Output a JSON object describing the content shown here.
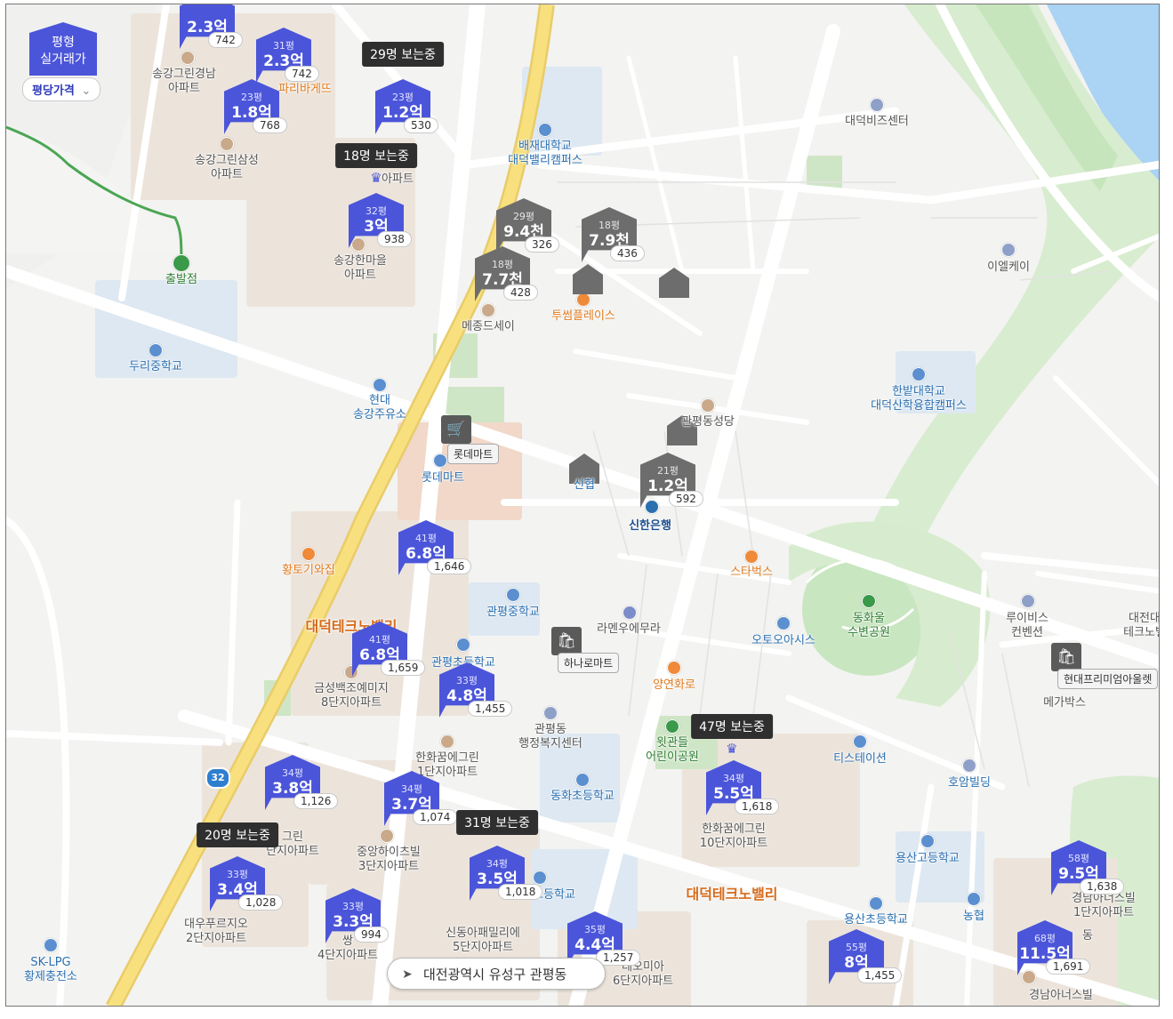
{
  "legend": {
    "line1": "평형",
    "line2": "실거래가",
    "select_value": "평당가격"
  },
  "address": {
    "text": "대전광역시 유성구 관평동"
  },
  "route_number": "32",
  "viewer_badges": [
    {
      "id": "v1",
      "text": "29명 보는중"
    },
    {
      "id": "v2",
      "text": "18명 보는중"
    },
    {
      "id": "v3",
      "text": "47명 보는중"
    },
    {
      "id": "v4",
      "text": "31명 보는중"
    },
    {
      "id": "v5",
      "text": "20명 보는중"
    }
  ],
  "price_markers": [
    {
      "id": "m0",
      "color": "blue",
      "pyeong": "",
      "price": "2.3억",
      "count": "742"
    },
    {
      "id": "m1",
      "color": "blue",
      "pyeong": "31평",
      "price": "2.3억",
      "count": "742"
    },
    {
      "id": "m2",
      "color": "blue",
      "pyeong": "23평",
      "price": "1.8억",
      "count": "768"
    },
    {
      "id": "m3",
      "color": "blue",
      "pyeong": "23평",
      "price": "1.2억",
      "count": "530"
    },
    {
      "id": "m4",
      "color": "blue",
      "pyeong": "32평",
      "price": "3억",
      "count": "938"
    },
    {
      "id": "m5",
      "color": "gray",
      "pyeong": "29평",
      "price": "9.4천",
      "count": "326"
    },
    {
      "id": "m6",
      "color": "gray",
      "pyeong": "18평",
      "price": "7.9천",
      "count": "436"
    },
    {
      "id": "m7",
      "color": "gray",
      "pyeong": "18평",
      "price": "7.7천",
      "count": "428"
    },
    {
      "id": "m8",
      "color": "gray",
      "pyeong": "21평",
      "price": "1.2억",
      "count": "592"
    },
    {
      "id": "m9",
      "color": "blue",
      "pyeong": "41평",
      "price": "6.8억",
      "count": "1,646"
    },
    {
      "id": "m10",
      "color": "blue",
      "pyeong": "41평",
      "price": "6.8억",
      "count": "1,659"
    },
    {
      "id": "m11",
      "color": "blue",
      "pyeong": "33평",
      "price": "4.8억",
      "count": "1,455"
    },
    {
      "id": "m12",
      "color": "blue",
      "pyeong": "34평",
      "price": "3.8억",
      "count": "1,126"
    },
    {
      "id": "m13",
      "color": "blue",
      "pyeong": "34평",
      "price": "3.7억",
      "count": "1,074"
    },
    {
      "id": "m14",
      "color": "blue",
      "pyeong": "34평",
      "price": "5.5억",
      "count": "1,618"
    },
    {
      "id": "m15",
      "color": "blue",
      "pyeong": "33평",
      "price": "3.4억",
      "count": "1,028"
    },
    {
      "id": "m16",
      "color": "blue",
      "pyeong": "34평",
      "price": "3.5억",
      "count": "1,018"
    },
    {
      "id": "m17",
      "color": "blue",
      "pyeong": "33평",
      "price": "3.3억",
      "count": "994"
    },
    {
      "id": "m18",
      "color": "blue",
      "pyeong": "35평",
      "price": "4.4억",
      "count": "1,257"
    },
    {
      "id": "m19",
      "color": "blue",
      "pyeong": "55평",
      "price": "8억",
      "count": "1,455"
    },
    {
      "id": "m20",
      "color": "blue",
      "pyeong": "58평",
      "price": "9.5억",
      "count": "1,638"
    },
    {
      "id": "m21",
      "color": "blue",
      "pyeong": "68평",
      "price": "11.5억",
      "count": "1,691"
    }
  ],
  "marts": [
    {
      "id": "lotte",
      "tag": "롯데마트"
    },
    {
      "id": "hanaro",
      "tag": "하나로마트"
    },
    {
      "id": "hyundai",
      "tag": "현대프리미엄아울렛"
    }
  ],
  "labels": [
    {
      "id": "l1",
      "text": "송강그린경남\n아파트"
    },
    {
      "id": "l2",
      "text": "파리바게뜨"
    },
    {
      "id": "l3",
      "text": "송강그린삼성\n아파트"
    },
    {
      "id": "l4",
      "text": "송강한마을\n아파트"
    },
    {
      "id": "l4b",
      "text": "아파트"
    },
    {
      "id": "l5",
      "text": "출발점"
    },
    {
      "id": "l6",
      "text": "두리중학교"
    },
    {
      "id": "l7",
      "text": "현대\n송강주유소"
    },
    {
      "id": "l8",
      "text": "배재대학교\n대덕밸리캠퍼스"
    },
    {
      "id": "l9",
      "text": "대덕비즈센터"
    },
    {
      "id": "l10",
      "text": "이엘케이"
    },
    {
      "id": "l11",
      "text": "메종드세이"
    },
    {
      "id": "l12",
      "text": "투썸플레이스"
    },
    {
      "id": "l13",
      "text": "한밭대학교\n대덕산학융합캠퍼스"
    },
    {
      "id": "l14",
      "text": "관평동성당"
    },
    {
      "id": "l15",
      "text": "롯데마트"
    },
    {
      "id": "l16",
      "text": "신협"
    },
    {
      "id": "l17",
      "text": "신한은행"
    },
    {
      "id": "l18",
      "text": "스타벅스"
    },
    {
      "id": "l19",
      "text": "황토기와집"
    },
    {
      "id": "l20",
      "text": "관평중학교"
    },
    {
      "id": "l21",
      "text": "라멘우에무라"
    },
    {
      "id": "l22",
      "text": "동화울\n수변공원"
    },
    {
      "id": "l23",
      "text": "루이비스\n컨벤션"
    },
    {
      "id": "l24",
      "text": "대전대\n테크노밸"
    },
    {
      "id": "l25",
      "text": "대덕테크노밸리"
    },
    {
      "id": "l26",
      "text": "관평초등학교"
    },
    {
      "id": "l27",
      "text": "오토오아시스"
    },
    {
      "id": "l28",
      "text": "양연화로"
    },
    {
      "id": "l29",
      "text": "금성백조예미지\n8단지아파트"
    },
    {
      "id": "l30",
      "text": "관평동\n행정복지센터"
    },
    {
      "id": "l31",
      "text": "윗관들\n어린이공원"
    },
    {
      "id": "l32",
      "text": "티스테이션"
    },
    {
      "id": "l33",
      "text": "메가박스"
    },
    {
      "id": "l34",
      "text": "한화꿈에그린\n1단지아파트"
    },
    {
      "id": "l35",
      "text": "호암빌딩"
    },
    {
      "id": "l36",
      "text": "동화초등학교"
    },
    {
      "id": "l37",
      "text": "한화꿈에그린\n10단지아파트"
    },
    {
      "id": "l38",
      "text": "그린\n단지아파트"
    },
    {
      "id": "l39",
      "text": "중앙하이츠빌\n3단지아파트"
    },
    {
      "id": "l40",
      "text": "대덕테크노밸리"
    },
    {
      "id": "l41",
      "text": "용산고등학교"
    },
    {
      "id": "l42",
      "text": "고등학교"
    },
    {
      "id": "l43",
      "text": "대우푸르지오\n2단지아파트"
    },
    {
      "id": "l44",
      "text": "쌍\n4단지아파트"
    },
    {
      "id": "l45",
      "text": "신동아패밀리에\n5단지아파트"
    },
    {
      "id": "l46",
      "text": "용산초등학교"
    },
    {
      "id": "l47",
      "text": "농협"
    },
    {
      "id": "l48",
      "text": "경남아너스빌\n1단지아파트"
    },
    {
      "id": "l49",
      "text": "SK-LPG\n황제충전소"
    },
    {
      "id": "l50",
      "text": "데오미아\n6단지아파트"
    },
    {
      "id": "l51",
      "text": "경남아너스빌"
    },
    {
      "id": "l52",
      "text": "동"
    }
  ]
}
